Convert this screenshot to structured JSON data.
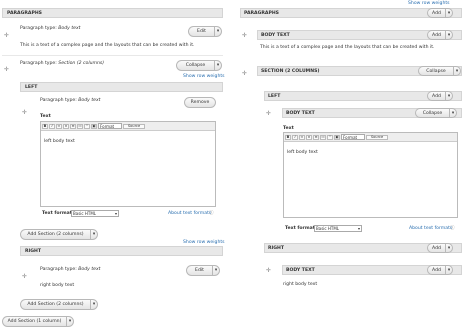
{
  "left": {
    "show_row_weights_top": "Show row weights",
    "paragraphs_title": "PARAGRAPHS",
    "p1_type_label": "Paragraph type:",
    "p1_type_value": "Body text",
    "p1_edit": "Edit",
    "p1_body": "This is a text of a complex page and the layouts that can be created with it.",
    "p2_type_label": "Paragraph type:",
    "p2_type_value": "Section (2 columns)",
    "p2_collapse": "Collapse",
    "show_row_weights_inner": "Show row weights",
    "left_region": "LEFT",
    "p3_type_label": "Paragraph type:",
    "p3_type_value": "Body text",
    "p3_remove": "Remove",
    "text_label": "Text",
    "format_label": "Format",
    "source_label": "Source",
    "editor_text": "left body text",
    "text_format_label": "Text format",
    "text_format_value": "Basic HTML",
    "about_formats": "About text formats",
    "add_section_2col_a": "Add Section (2 columns)",
    "show_row_weights_bottom": "Show row weights",
    "right_region": "RIGHT",
    "p4_type_label": "Paragraph type:",
    "p4_type_value": "Body text",
    "p4_edit": "Edit",
    "p4_body": "right body text",
    "add_section_2col_b": "Add Section (2 columns)",
    "add_section_1col": "Add Section (1 column)"
  },
  "right": {
    "paragraphs_title": "PARAGRAPHS",
    "add": "Add",
    "body_text_title": "BODY TEXT",
    "body_text_add": "Add",
    "p1_body": "This is a text of a complex page and the layouts that can be created with it.",
    "section_title": "SECTION (2 COLUMNS)",
    "section_collapse": "Collapse",
    "left_region": "LEFT",
    "left_add": "Add",
    "left_body_title": "BODY TEXT",
    "left_body_collapse": "Collapse",
    "text_label": "Text",
    "format_label": "Format",
    "source_label": "Source",
    "editor_text": "left body text",
    "text_format_label": "Text format",
    "text_format_value": "Basic HTML",
    "about_formats": "About text formats",
    "right_region": "RIGHT",
    "right_add": "Add",
    "right_body_title": "BODY TEXT",
    "right_body_add": "Add",
    "right_body_text": "right body text"
  }
}
